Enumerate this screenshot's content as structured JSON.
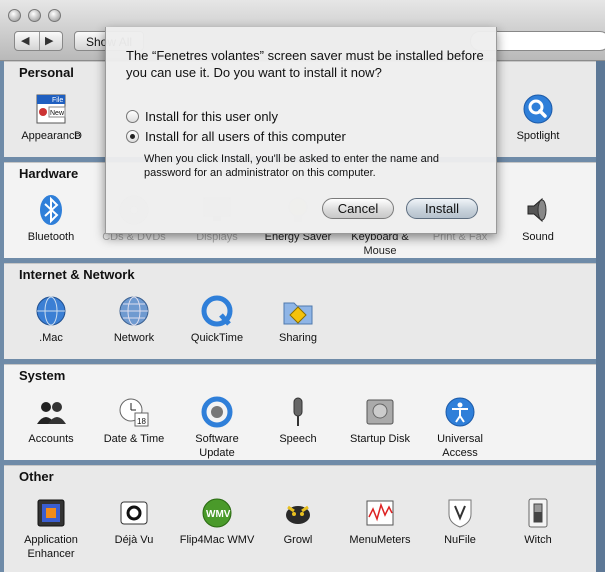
{
  "toolbar": {
    "back_glyph": "◀",
    "forward_glyph": "▶",
    "show_all_label": "Show All"
  },
  "sections": {
    "personal": {
      "title": "Personal",
      "items": [
        "Appearance",
        "D",
        "Spotlight"
      ],
      "appearance_icon_text": [
        "File",
        "New"
      ]
    },
    "hardware": {
      "title": "Hardware",
      "items": [
        "Bluetooth",
        "CDs & DVDs",
        "Displays",
        "Energy Saver",
        "Keyboard & Mouse",
        "Print & Fax",
        "Sound"
      ]
    },
    "internet": {
      "title": "Internet & Network",
      "items": [
        ".Mac",
        "Network",
        "QuickTime",
        "Sharing"
      ]
    },
    "system": {
      "title": "System",
      "items": [
        "Accounts",
        "Date & Time",
        "Software Update",
        "Speech",
        "Startup Disk",
        "Universal Access"
      ]
    },
    "other": {
      "title": "Other",
      "items": [
        "Application Enhancer",
        "Déjà Vu",
        "Flip4Mac WMV",
        "Growl",
        "MenuMeters",
        "NuFile",
        "Witch"
      ]
    }
  },
  "date_icon_number": "18",
  "wmv_icon_text": "WMV",
  "sheet": {
    "message": "The “Fenetres volantes” screen saver must be installed before you can use it. Do you want to install it now?",
    "option_user": "Install for this user only",
    "option_all": "Install for all users of this computer",
    "selected_option": "all",
    "note": "When you click Install, you'll be asked to enter the name and password for an administrator on this computer.",
    "cancel_label": "Cancel",
    "install_label": "Install"
  },
  "colors": {
    "accent_blue": "#2f7fd9",
    "desktop": "#6f8ba8"
  }
}
